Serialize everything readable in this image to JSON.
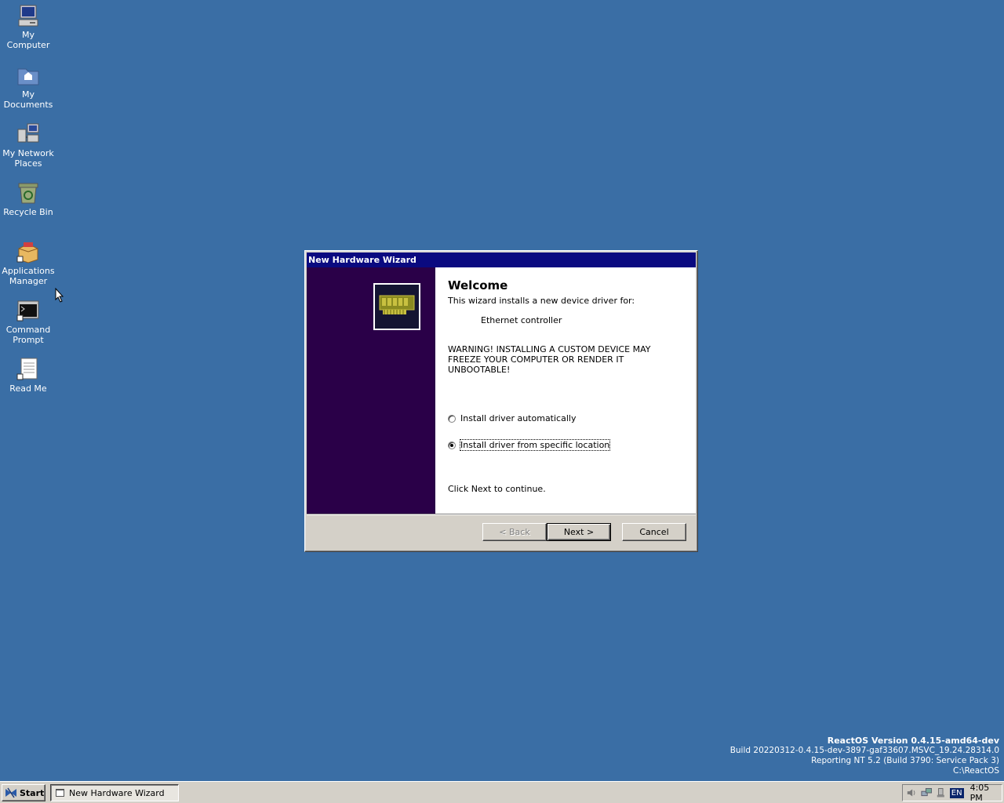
{
  "desktop": {
    "icons": [
      {
        "label": "My\nComputer",
        "icon": "my-computer-icon"
      },
      {
        "label": "My\nDocuments",
        "icon": "my-documents-icon"
      },
      {
        "label": "My Network\nPlaces",
        "icon": "network-places-icon"
      },
      {
        "label": "Recycle Bin",
        "icon": "recycle-bin-icon"
      },
      {
        "label": "Applications\nManager",
        "icon": "applications-manager-icon"
      },
      {
        "label": "Command\nPrompt",
        "icon": "command-prompt-icon"
      },
      {
        "label": "Read Me",
        "icon": "read-me-icon"
      }
    ],
    "background_color": "#3a6ea5"
  },
  "version_info": {
    "line1": "ReactOS Version 0.4.15-amd64-dev",
    "line2": "Build 20220312-0.4.15-dev-3897-gaf33607.MSVC_19.24.28314.0",
    "line3": "Reporting NT 5.2 (Build 3790: Service Pack 3)",
    "line4": "C:\\ReactOS"
  },
  "dialog": {
    "title": "New Hardware Wizard",
    "heading": "Welcome",
    "subtitle": "This wizard installs a new device driver for:",
    "device": "Ethernet controller",
    "warning": "WARNING! INSTALLING A CUSTOM DEVICE MAY FREEZE YOUR COMPUTER OR RENDER IT UNBOOTABLE!",
    "options": [
      {
        "label": "Install driver automatically",
        "checked": false
      },
      {
        "label": "Install driver from specific location",
        "checked": true
      }
    ],
    "continue_text": "Click Next to continue.",
    "buttons": {
      "back": "< Back",
      "next": "Next >",
      "cancel": "Cancel"
    },
    "sidebar_color": "#2a0048",
    "title_color": "#0a0a80"
  },
  "taskbar": {
    "start_label": "Start",
    "task_label": "New Hardware Wizard",
    "language": "EN",
    "clock": "4:05 PM"
  }
}
